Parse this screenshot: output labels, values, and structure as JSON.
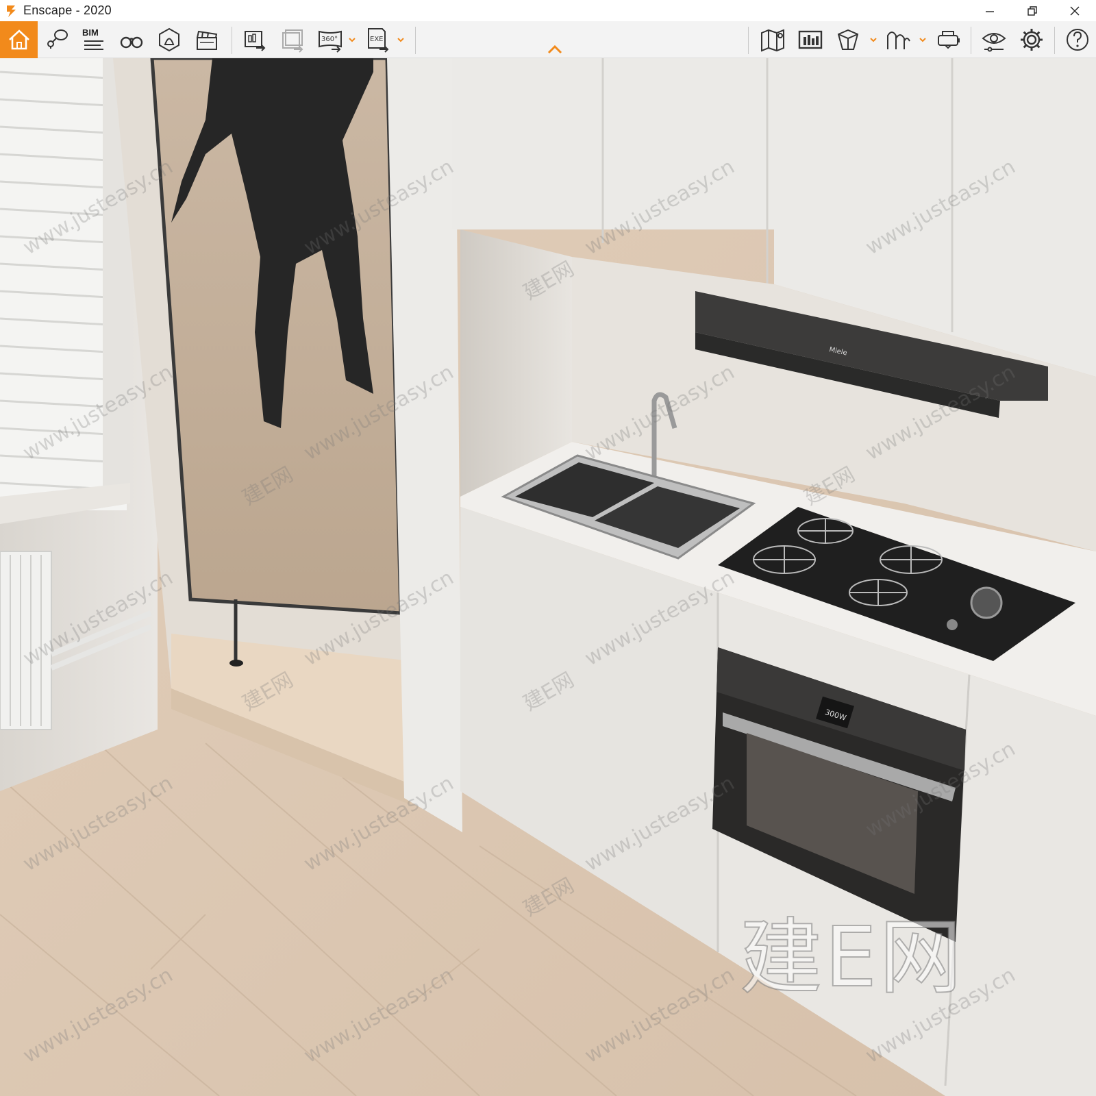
{
  "window": {
    "title": "Enscape - 2020",
    "controls": {
      "minimize_icon": "minimize-icon",
      "restore_icon": "restore-icon",
      "close_icon": "close-icon"
    }
  },
  "toolbar": {
    "accent_color": "#f28a1b",
    "bim_label": "BIM",
    "buttons": [
      {
        "id": "home",
        "icon": "home-icon"
      },
      {
        "id": "views",
        "icon": "location-pin-icon"
      },
      {
        "id": "bim",
        "icon": "bim-list-icon"
      },
      {
        "id": "fly",
        "icon": "binoculars-icon"
      },
      {
        "id": "assets",
        "icon": "asset-library-icon"
      },
      {
        "id": "video",
        "icon": "clapperboard-icon"
      },
      {
        "id": "batch-render",
        "icon": "batch-render-icon"
      },
      {
        "id": "panorama-export",
        "icon": "panorama-export-icon"
      },
      {
        "id": "360",
        "icon": "panorama-360-icon",
        "label": "360°"
      },
      {
        "id": "exe",
        "icon": "exe-export-icon",
        "label": "EXE"
      },
      {
        "id": "map",
        "icon": "map-icon"
      },
      {
        "id": "gallery",
        "icon": "gallery-icon"
      },
      {
        "id": "section",
        "icon": "cube-icon"
      },
      {
        "id": "light-view",
        "icon": "light-view-icon"
      },
      {
        "id": "vr",
        "icon": "vr-headset-icon"
      },
      {
        "id": "visual-settings",
        "icon": "eye-settings-icon"
      },
      {
        "id": "settings",
        "icon": "gear-icon"
      },
      {
        "id": "help",
        "icon": "help-icon"
      }
    ],
    "collapse_icon": "chevron-up-icon"
  },
  "viewport": {
    "watermark_brand": "建E网",
    "watermark_tiles": [
      "www.justeasy.cn",
      "建E网"
    ],
    "oven_display": "300W",
    "hood_brand": "Miele"
  }
}
